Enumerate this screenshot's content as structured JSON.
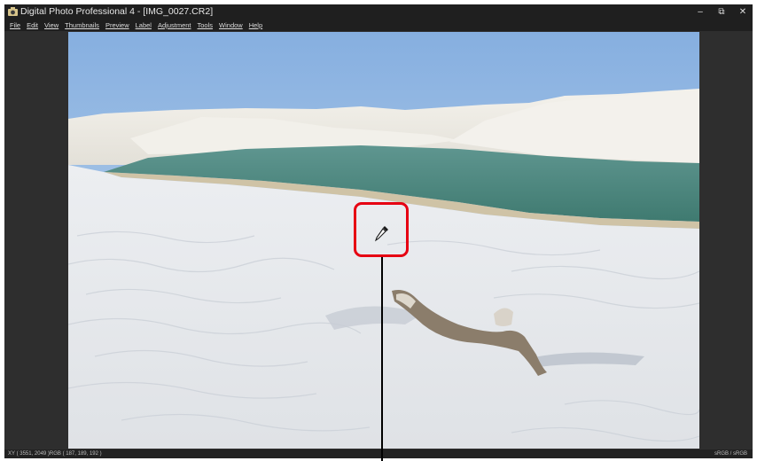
{
  "window": {
    "title": "Digital Photo Professional 4 - [IMG_0027.CR2]",
    "controls": {
      "minimize": "–",
      "restore": "⧉",
      "close": "✕"
    }
  },
  "menu": [
    "File",
    "Edit",
    "View",
    "Thumbnails",
    "Preview",
    "Label",
    "Adjustment",
    "Tools",
    "Window",
    "Help"
  ],
  "status": {
    "left": "XY  ( 3551, 2049 )RGB ( 187, 189, 192 )",
    "right": "sRGB / sRGB"
  },
  "colors": {
    "callout": "#e60012",
    "sky_top": "#8fb6e3",
    "water": "#4f8a80",
    "sand": "#e9eaec"
  },
  "icons": {
    "cursor": "eyedropper-icon",
    "app": "app-icon"
  }
}
